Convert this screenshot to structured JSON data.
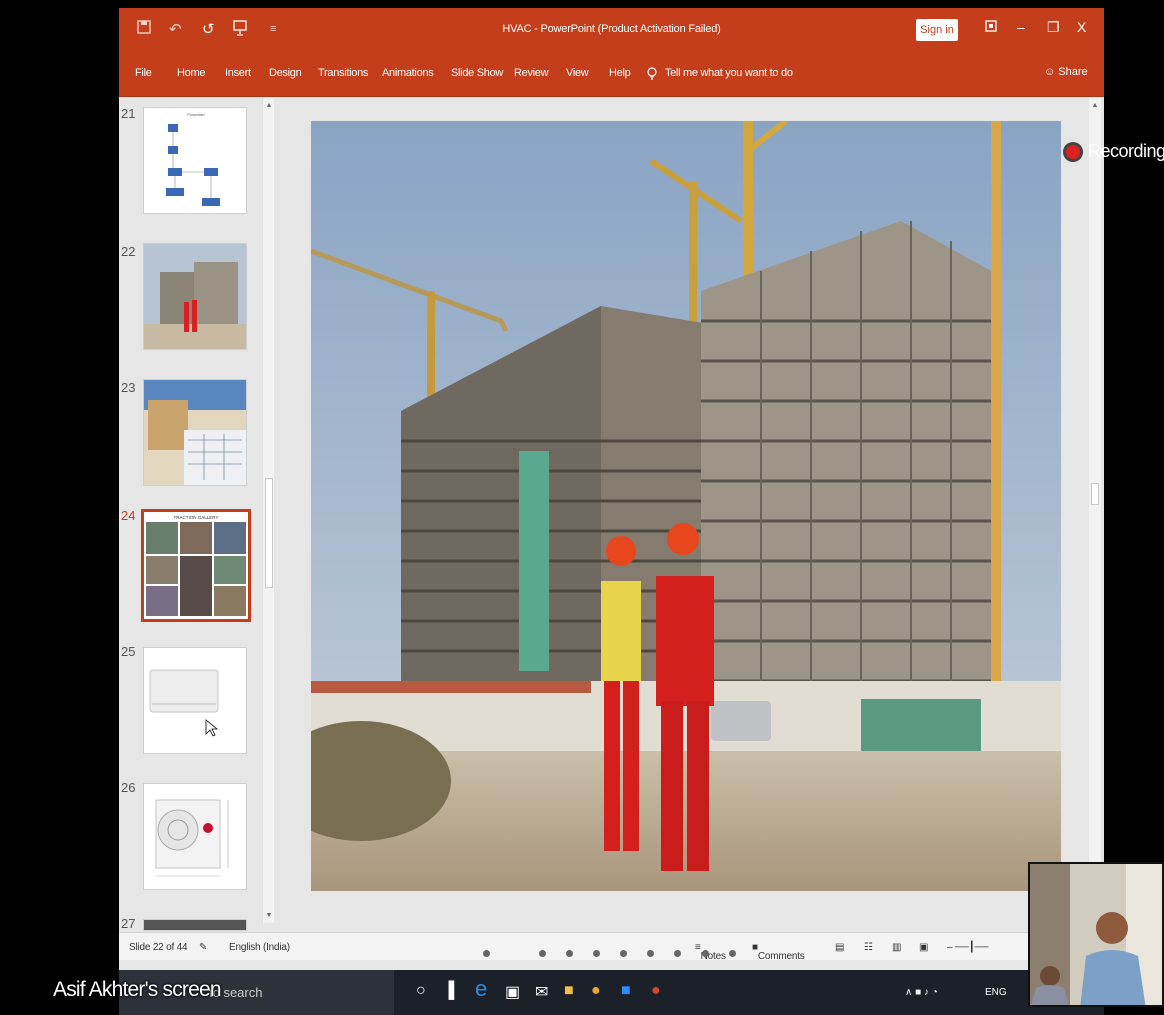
{
  "window": {
    "title": "HVAC - PowerPoint (Product Activation Failed)",
    "sign_in": "Sign in",
    "share": "Share"
  },
  "ribbon": {
    "tabs": [
      "File",
      "Home",
      "Insert",
      "Design",
      "Transitions",
      "Animations",
      "Slide Show",
      "Review",
      "View",
      "Help"
    ],
    "tell_me": "Tell me what you want to do"
  },
  "thumbnails": [
    {
      "num": "21",
      "kind": "flowchart",
      "active": false
    },
    {
      "num": "22",
      "kind": "construction",
      "active": false
    },
    {
      "num": "23",
      "kind": "blueprint",
      "active": false
    },
    {
      "num": "24",
      "kind": "gallery",
      "active": true
    },
    {
      "num": "25",
      "kind": "ac-indoor",
      "active": false
    },
    {
      "num": "26",
      "kind": "ac-outdoor",
      "active": false
    },
    {
      "num": "27",
      "kind": "partial",
      "active": false
    }
  ],
  "thumb_gallery_title": "TRACTION GALLERY",
  "status": {
    "slide_counter": "Slide 22 of 44",
    "language": "English (India)",
    "notes": "Notes",
    "comments": "Comments"
  },
  "taskbar": {
    "search_placeholder": "to search",
    "language": "ENG"
  },
  "overlay": {
    "recording": "Recording",
    "sharer": "Asif Akhter's screen"
  },
  "colors": {
    "accent": "#c43e1c",
    "taskbar": "#1c2129",
    "recording_dot": "#e02020"
  },
  "icons": [
    "save-icon",
    "undo-icon",
    "redo-icon",
    "present-icon",
    "customize-icon",
    "lightbulb-icon",
    "share-person-icon",
    "restore-icon",
    "minimize-icon",
    "maximize-icon",
    "close-icon",
    "edge-icon",
    "store-icon",
    "mail-icon",
    "explorer-icon",
    "chrome-icon",
    "zoom-icon",
    "powerpoint-icon"
  ]
}
